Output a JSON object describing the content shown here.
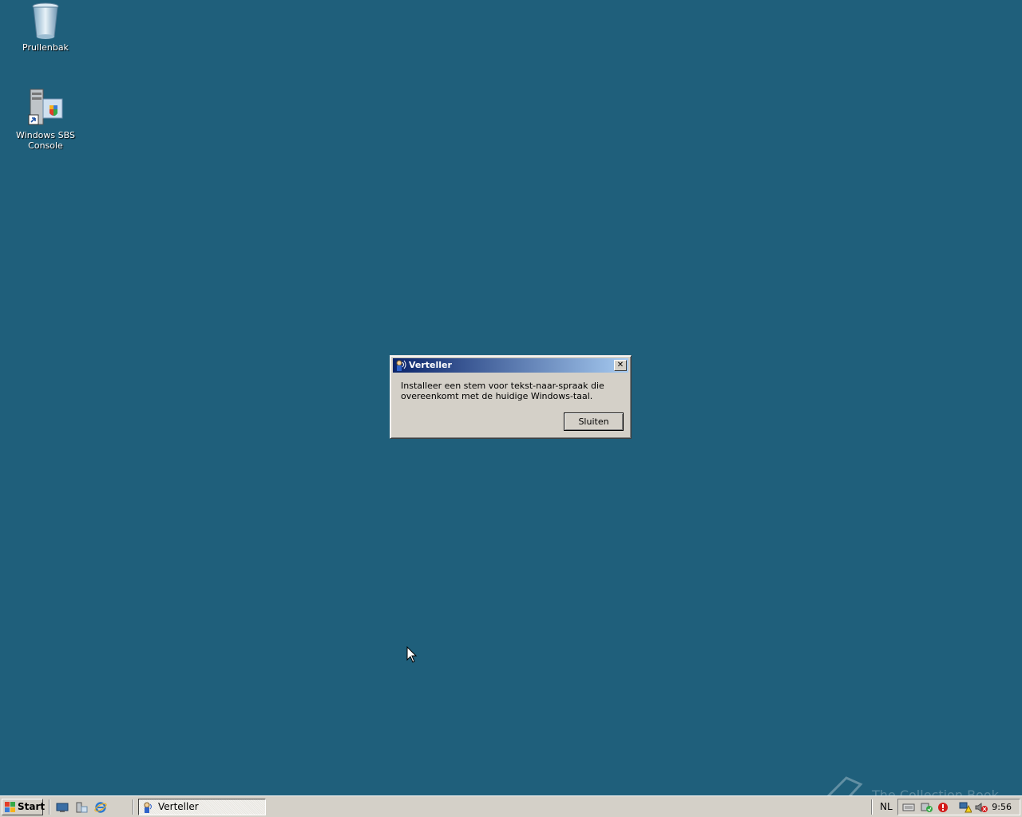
{
  "desktop": {
    "icons": [
      {
        "label": "Prullenbak",
        "icon": "recycle-bin-icon"
      },
      {
        "label": "Windows SBS Console",
        "icon": "server-console-icon"
      }
    ],
    "background_color": "#1f5f7b"
  },
  "dialog": {
    "title": "Verteller",
    "close_glyph": "✕",
    "message": "Installeer een stem voor tekst-naar-spraak die overeenkomt met de huidige Windows-taal.",
    "button_label": "Sluiten"
  },
  "taskbar": {
    "start_label": "Start",
    "quick_launch": [
      "show-desktop-icon",
      "server-manager-icon",
      "internet-explorer-icon"
    ],
    "tasks": [
      {
        "label": "Verteller",
        "icon": "narrator-icon",
        "active": true
      }
    ],
    "language": "NL",
    "tray_icons": [
      "keyboard-icon",
      "security-icon",
      "alert-icon",
      "network-warning-icon",
      "volume-muted-icon"
    ],
    "clock": "9:56"
  },
  "watermark": {
    "text": "The Collection Book"
  }
}
